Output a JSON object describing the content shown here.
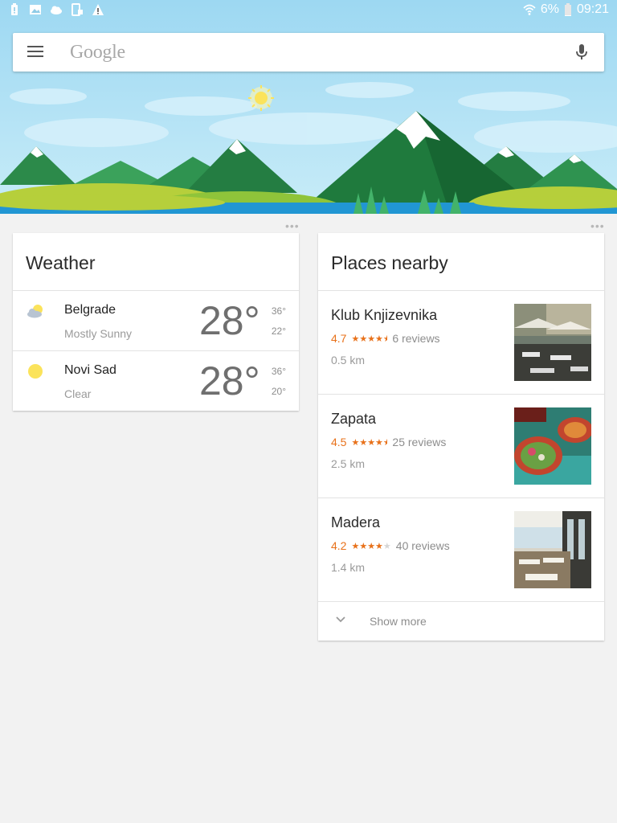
{
  "status_bar": {
    "battery_percent": "6%",
    "time": "09:21"
  },
  "search": {
    "logo_text": "Google"
  },
  "weather_card": {
    "title": "Weather",
    "rows": [
      {
        "city": "Belgrade",
        "condition": "Mostly Sunny",
        "temp": "28°",
        "high": "36°",
        "low": "22°",
        "icon": "partly-sunny-icon"
      },
      {
        "city": "Novi Sad",
        "condition": "Clear",
        "temp": "28°",
        "high": "36°",
        "low": "20°",
        "icon": "sun-icon"
      }
    ]
  },
  "places_card": {
    "title": "Places nearby",
    "places": [
      {
        "name": "Klub Knjizevnika",
        "rating": "4.7",
        "stars": 4.5,
        "reviews": "6 reviews",
        "distance": "0.5 km"
      },
      {
        "name": "Zapata",
        "rating": "4.5",
        "stars": 4.5,
        "reviews": "25 reviews",
        "distance": "2.5 km"
      },
      {
        "name": "Madera",
        "rating": "4.2",
        "stars": 4,
        "reviews": "40 reviews",
        "distance": "1.4 km"
      }
    ],
    "show_more_label": "Show more"
  },
  "colors": {
    "accent_orange": "#e8711a",
    "sky": "#8fd0ee",
    "sun": "#fbe35b"
  }
}
